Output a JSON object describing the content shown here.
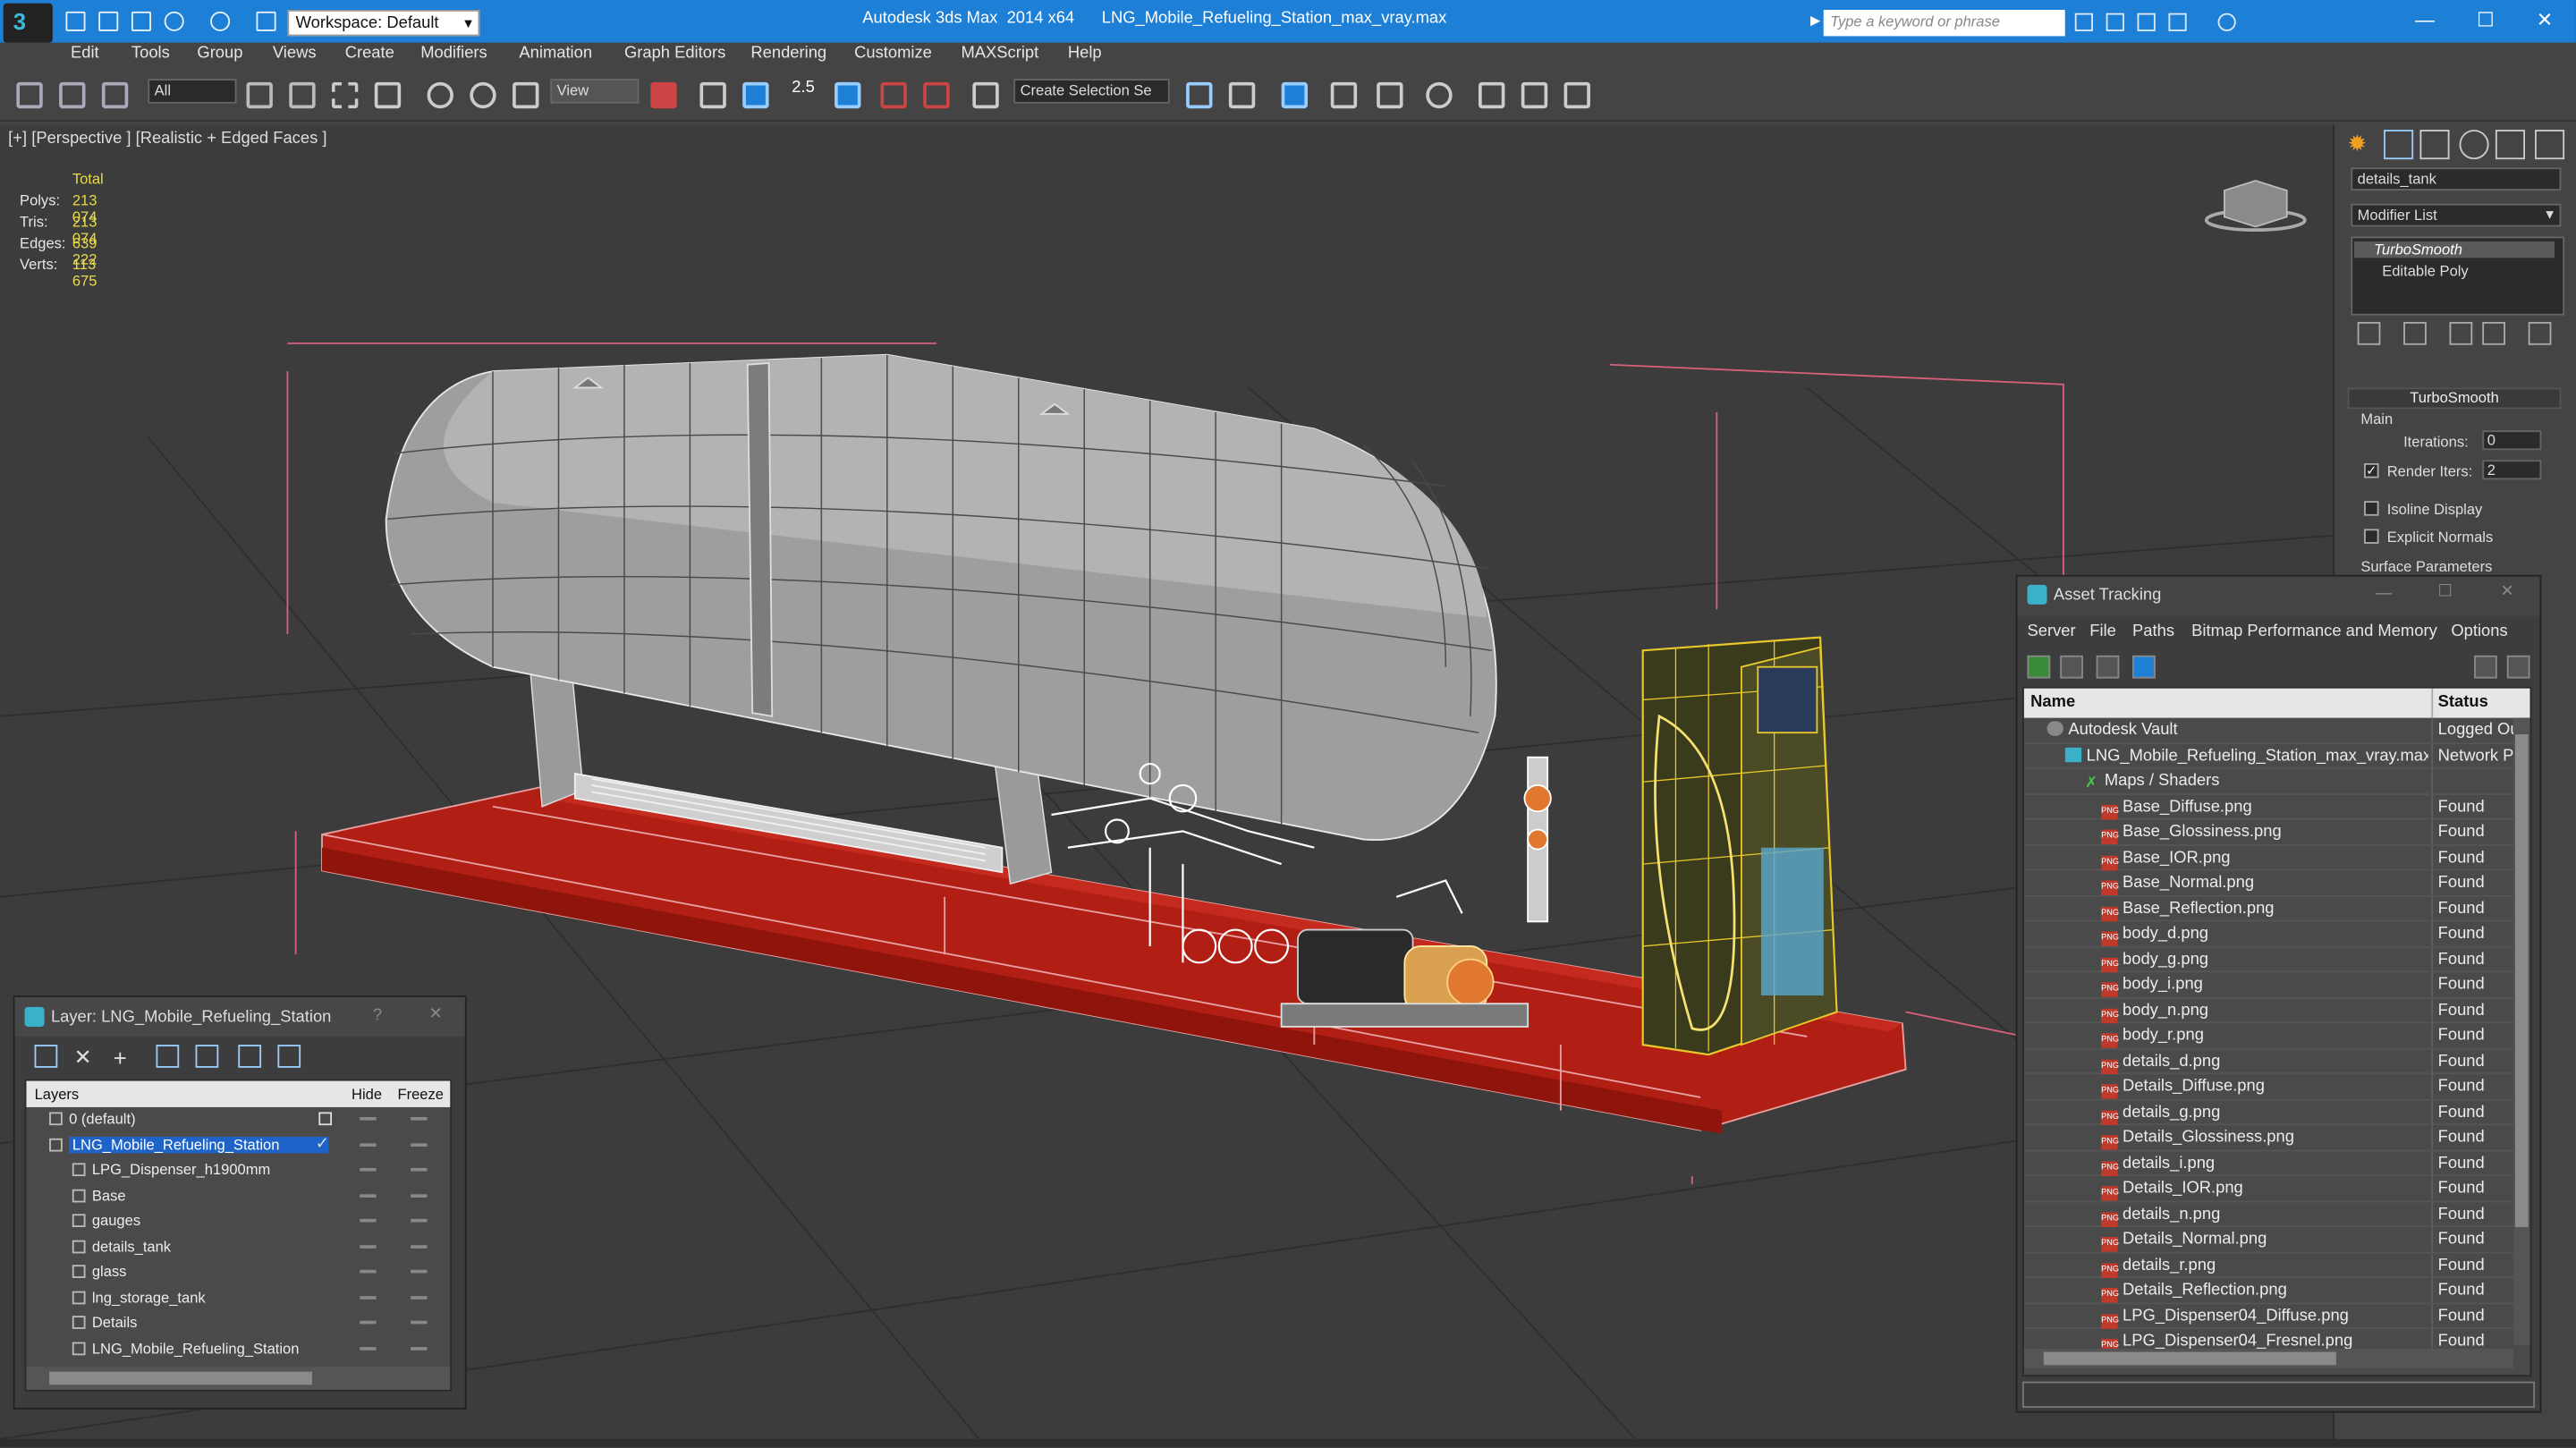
{
  "titlebar": {
    "workspace": "Workspace: Default",
    "title": "Autodesk 3ds Max  2014 x64      LNG_Mobile_Refueling_Station_max_vray.max",
    "search_placeholder": "Type a keyword or phrase"
  },
  "menu": [
    "Edit",
    "Tools",
    "Group",
    "Views",
    "Create",
    "Modifiers",
    "Animation",
    "Graph Editors",
    "Rendering",
    "Customize",
    "MAXScript",
    "Help"
  ],
  "toolbar": {
    "filter": "All",
    "refcoord": "View",
    "selection_set": "Create Selection Se",
    "snap_value": "2.5"
  },
  "viewport": {
    "label": "[+] [Perspective ] [Realistic + Edged Faces ]",
    "stats_header": "Total",
    "stats": [
      {
        "k": "Polys:",
        "v": "213 074"
      },
      {
        "k": "Tris:",
        "v": "213 074"
      },
      {
        "k": "Edges:",
        "v": "639 222"
      },
      {
        "k": "Verts:",
        "v": "113 675"
      }
    ]
  },
  "command_panel": {
    "object_name": "details_tank",
    "modifier_list": "Modifier List",
    "stack": [
      "TurboSmooth",
      "Editable Poly"
    ],
    "rollout": "TurboSmooth",
    "main_label": "Main",
    "iterations_label": "Iterations:",
    "iterations_value": "0",
    "render_iters_label": "Render Iters:",
    "render_iters_value": "2",
    "isoline_label": "Isoline Display",
    "explicit_normals_label": "Explicit Normals",
    "surface_params_label": "Surface Parameters"
  },
  "asset_tracking": {
    "title": "Asset Tracking",
    "menu": [
      "Server",
      "File",
      "Paths",
      "Bitmap Performance and Memory",
      "Options"
    ],
    "col_name": "Name",
    "col_status": "Status",
    "rows": [
      {
        "name": "Autodesk Vault",
        "status": "Logged Ou",
        "indent": 0,
        "icon": "vault"
      },
      {
        "name": "LNG_Mobile_Refueling_Station_max_vray.max",
        "status": "Network P",
        "indent": 1,
        "icon": "max"
      },
      {
        "name": "Maps / Shaders",
        "status": "",
        "indent": 2,
        "icon": "maps"
      },
      {
        "name": "Base_Diffuse.png",
        "status": "Found",
        "indent": 3,
        "icon": "png"
      },
      {
        "name": "Base_Glossiness.png",
        "status": "Found",
        "indent": 3,
        "icon": "png"
      },
      {
        "name": "Base_IOR.png",
        "status": "Found",
        "indent": 3,
        "icon": "png"
      },
      {
        "name": "Base_Normal.png",
        "status": "Found",
        "indent": 3,
        "icon": "png"
      },
      {
        "name": "Base_Reflection.png",
        "status": "Found",
        "indent": 3,
        "icon": "png"
      },
      {
        "name": "body_d.png",
        "status": "Found",
        "indent": 3,
        "icon": "png"
      },
      {
        "name": "body_g.png",
        "status": "Found",
        "indent": 3,
        "icon": "png"
      },
      {
        "name": "body_i.png",
        "status": "Found",
        "indent": 3,
        "icon": "png"
      },
      {
        "name": "body_n.png",
        "status": "Found",
        "indent": 3,
        "icon": "png"
      },
      {
        "name": "body_r.png",
        "status": "Found",
        "indent": 3,
        "icon": "png"
      },
      {
        "name": "details_d.png",
        "status": "Found",
        "indent": 3,
        "icon": "png"
      },
      {
        "name": "Details_Diffuse.png",
        "status": "Found",
        "indent": 3,
        "icon": "png"
      },
      {
        "name": "details_g.png",
        "status": "Found",
        "indent": 3,
        "icon": "png"
      },
      {
        "name": "Details_Glossiness.png",
        "status": "Found",
        "indent": 3,
        "icon": "png"
      },
      {
        "name": "details_i.png",
        "status": "Found",
        "indent": 3,
        "icon": "png"
      },
      {
        "name": "Details_IOR.png",
        "status": "Found",
        "indent": 3,
        "icon": "png"
      },
      {
        "name": "details_n.png",
        "status": "Found",
        "indent": 3,
        "icon": "png"
      },
      {
        "name": "Details_Normal.png",
        "status": "Found",
        "indent": 3,
        "icon": "png"
      },
      {
        "name": "details_r.png",
        "status": "Found",
        "indent": 3,
        "icon": "png"
      },
      {
        "name": "Details_Reflection.png",
        "status": "Found",
        "indent": 3,
        "icon": "png"
      },
      {
        "name": "LPG_Dispenser04_Diffuse.png",
        "status": "Found",
        "indent": 3,
        "icon": "png"
      },
      {
        "name": "LPG_Dispenser04_Fresnel.png",
        "status": "Found",
        "indent": 3,
        "icon": "png"
      }
    ]
  },
  "layer_dialog": {
    "title": "Layer: LNG_Mobile_Refueling_Station",
    "help": "?",
    "col_layers": "Layers",
    "col_hide": "Hide",
    "col_freeze": "Freeze",
    "rows": [
      {
        "name": "0 (default)",
        "level": 0,
        "selected": false
      },
      {
        "name": "LNG_Mobile_Refueling_Station",
        "level": 0,
        "selected": true
      },
      {
        "name": "LPG_Dispenser_h1900mm",
        "level": 1,
        "selected": false
      },
      {
        "name": "Base",
        "level": 1,
        "selected": false
      },
      {
        "name": "gauges",
        "level": 1,
        "selected": false
      },
      {
        "name": "details_tank",
        "level": 1,
        "selected": false
      },
      {
        "name": "glass",
        "level": 1,
        "selected": false
      },
      {
        "name": "lng_storage_tank",
        "level": 1,
        "selected": false
      },
      {
        "name": "Details",
        "level": 1,
        "selected": false
      },
      {
        "name": "LNG_Mobile_Refueling_Station",
        "level": 1,
        "selected": false
      }
    ]
  },
  "colors": {
    "titlebar": "#1e7fd6",
    "base_frame": "#b01e14",
    "wire_yellow": "#e8c82a",
    "selected_row": "#1e64c8"
  }
}
